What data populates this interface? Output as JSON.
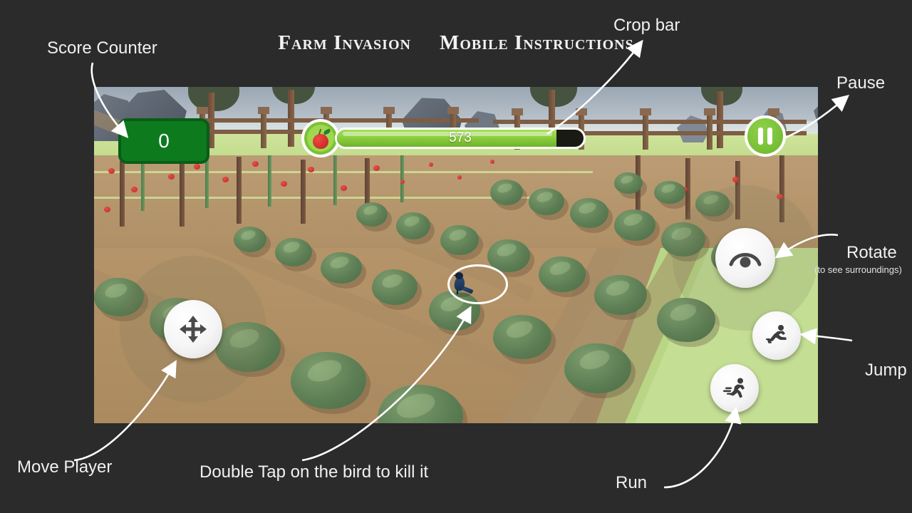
{
  "title": {
    "game_name": "Farm Invasion",
    "subtitle": "Mobile Instructions"
  },
  "hud": {
    "score_label": "Score Counter",
    "score_value": "0",
    "crop_bar_label": "Crop bar",
    "crop_bar_value": "573",
    "crop_bar_fill_percent": 89,
    "apple_icon": "apple-icon",
    "pause_icon": "pause-icon",
    "pause_label": "Pause"
  },
  "controls": {
    "move": {
      "label": "Move Player",
      "icon": "move-arrows-icon"
    },
    "rotate": {
      "label": "Rotate",
      "sublabel": "(to see surroundings)",
      "icon": "eye-icon"
    },
    "jump": {
      "label": "Jump",
      "icon": "jumping-person-icon"
    },
    "run": {
      "label": "Run",
      "icon": "running-person-icon"
    }
  },
  "annotations": {
    "double_tap": "Double Tap on the bird to kill it"
  },
  "colors": {
    "background": "#2b2b2b",
    "score_green": "#0d7a1e",
    "crop_green": "#8ccf3f",
    "pause_green": "#6bb62c",
    "text_white": "#f0f0f0",
    "apple_red": "#c0211f",
    "bird_blue": "#16304f"
  }
}
